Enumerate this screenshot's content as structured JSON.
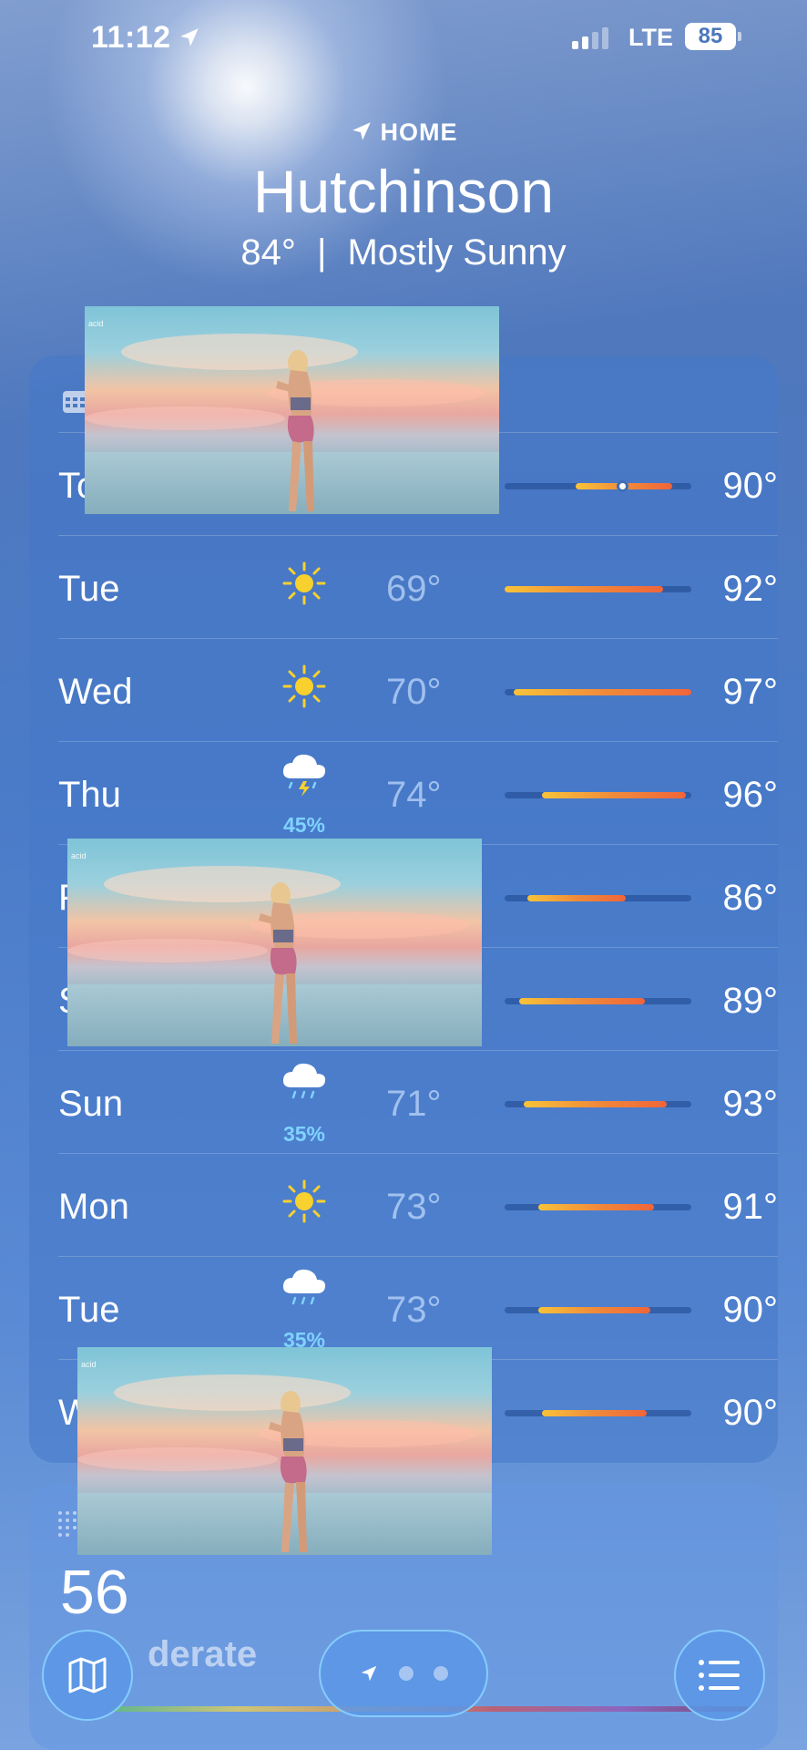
{
  "status_bar": {
    "time": "11:12",
    "network": "LTE",
    "battery": "85"
  },
  "header": {
    "home_label": "HOME",
    "city": "Hutchinson",
    "current_temp": "84°",
    "separator": "|",
    "condition": "Mostly Sunny"
  },
  "forecast": {
    "rows": [
      {
        "day": "To",
        "icon": "sun-icon",
        "precip": "",
        "low": "",
        "high": "90°",
        "range_start": 0.38,
        "range_end": 0.9,
        "current": 0.63
      },
      {
        "day": "Tue",
        "icon": "sun-icon",
        "precip": "",
        "low": "69°",
        "high": "92°",
        "range_start": 0.0,
        "range_end": 0.85
      },
      {
        "day": "Wed",
        "icon": "sun-icon",
        "precip": "",
        "low": "70°",
        "high": "97°",
        "range_start": 0.05,
        "range_end": 1.0
      },
      {
        "day": "Thu",
        "icon": "thunderstorm-icon",
        "precip": "45%",
        "low": "74°",
        "high": "96°",
        "range_start": 0.2,
        "range_end": 0.97
      },
      {
        "day": "F",
        "icon": "",
        "precip": "",
        "low": "",
        "high": "86°",
        "range_start": 0.12,
        "range_end": 0.65
      },
      {
        "day": "S",
        "icon": "",
        "precip": "",
        "low": "",
        "high": "89°",
        "range_start": 0.08,
        "range_end": 0.75
      },
      {
        "day": "Sun",
        "icon": "rain-cloud-icon",
        "precip": "35%",
        "low": "71°",
        "high": "93°",
        "range_start": 0.1,
        "range_end": 0.87
      },
      {
        "day": "Mon",
        "icon": "sun-icon",
        "precip": "",
        "low": "73°",
        "high": "91°",
        "range_start": 0.18,
        "range_end": 0.8
      },
      {
        "day": "Tue",
        "icon": "rain-cloud-icon",
        "precip": "35%",
        "low": "73°",
        "high": "90°",
        "range_start": 0.18,
        "range_end": 0.78
      },
      {
        "day": "W",
        "icon": "",
        "precip": "",
        "low": "",
        "high": "90°",
        "range_start": 0.2,
        "range_end": 0.76
      }
    ]
  },
  "air_quality": {
    "value": "56",
    "label": "derate"
  },
  "overlay_tag": "acid",
  "colors": {
    "accent_precip": "#7fd2ff",
    "bar_warm": "#f0653a",
    "bar_yellow": "#f8c33a"
  }
}
